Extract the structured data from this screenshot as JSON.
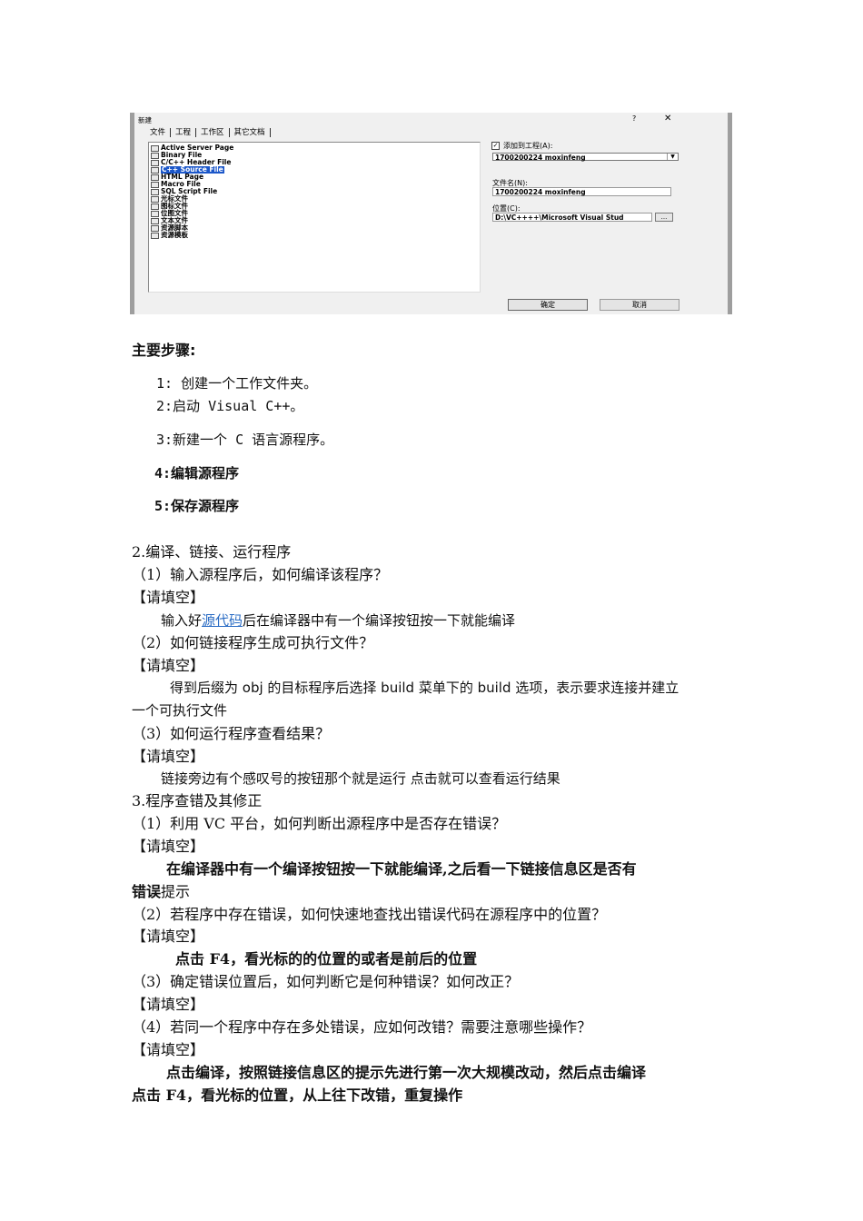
{
  "dialog": {
    "title": "新建",
    "help": "?",
    "close": "✕",
    "tabs": [
      "文件",
      "工程",
      "工作区",
      "其它文档"
    ],
    "file_types": [
      {
        "label": "Active Server Page",
        "icon": "asp-file-icon"
      },
      {
        "label": "Binary File",
        "icon": "binary-file-icon"
      },
      {
        "label": "C/C++ Header File",
        "icon": "header-file-icon"
      },
      {
        "label": "C++ Source File",
        "icon": "cpp-file-icon",
        "selected": true
      },
      {
        "label": "HTML Page",
        "icon": "html-file-icon"
      },
      {
        "label": "Macro File",
        "icon": "macro-file-icon"
      },
      {
        "label": "SQL Script File",
        "icon": "sql-file-icon"
      },
      {
        "label": "光标文件",
        "icon": "cursor-file-icon"
      },
      {
        "label": "图标文件",
        "icon": "icon-file-icon"
      },
      {
        "label": "位图文件",
        "icon": "bitmap-file-icon"
      },
      {
        "label": "文本文件",
        "icon": "text-file-icon"
      },
      {
        "label": "资源脚本",
        "icon": "resource-script-icon"
      },
      {
        "label": "资源模板",
        "icon": "resource-template-icon"
      }
    ],
    "add_to_project_label": "添加到工程(A):",
    "add_to_project_checked": true,
    "project_value": "1700200224 moxinfeng",
    "filename_label": "文件名(N):",
    "filename_value": "1700200224 moxinfeng",
    "location_label": "位置(C):",
    "location_value": "D:\\VC++++\\Microsoft Visual Stud",
    "browse_label": "...",
    "ok_label": "确定",
    "cancel_label": "取消"
  },
  "doc": {
    "steps_heading": "主要步骤:",
    "step1": "1: 创建一个工作文件夹。",
    "step2": "2:启动 Visual C++。",
    "step3": "3:新建一个 C 语言源程序。",
    "step4": "4:编辑源程序",
    "step5": "5:保存源程序",
    "sec2": "2.编译、链接、运行程序",
    "q2_1": "（1）输入源程序后，如何编译该程序？",
    "fill": "【请填空】",
    "a2_1_pre": "输入好",
    "a2_1_link": "源代码",
    "a2_1_post": "后在编译器中有一个编译按钮按一下就能编译",
    "q2_2": "（2）如何链接程序生成可执行文件？",
    "a2_2_line1": "得到后缀为 obj 的目标程序后选择 build 菜单下的 build 选项，表示要求连接并建立",
    "a2_2_line2": "一个可执行文件",
    "q2_3": "（3）如何运行程序查看结果？",
    "a2_3": "链接旁边有个感叹号的按钮那个就是运行 点击就可以查看运行结果",
    "sec3": "3.程序查错及其修正",
    "q3_1": "（1）利用 VC 平台，如何判断出源程序中是否存在错误？",
    "a3_1_line1": "在编译器中有一个编译按钮按一下就能编译,之后看一下链接信息区是否有",
    "a3_1_line2_bold": "错误",
    "a3_1_line2_rest": "提示",
    "q3_2": "（2）若程序中存在错误，如何快速地查找出错误代码在源程序中的位置？",
    "a3_2": "点击 F4，看光标的的位置的或者是前后的位置",
    "q3_3": "（3）确定错误位置后，如何判断它是何种错误？如何改正？",
    "q3_4": "（4）若同一个程序中存在多处错误，应如何改错？需要注意哪些操作？",
    "a3_4_line1": "点击编译，按照链接信息区的提示先进行第一次大规模改动，然后点击编译",
    "a3_4_line2": "点击 F4，看光标的位置，从上往下改错，重复操作"
  }
}
